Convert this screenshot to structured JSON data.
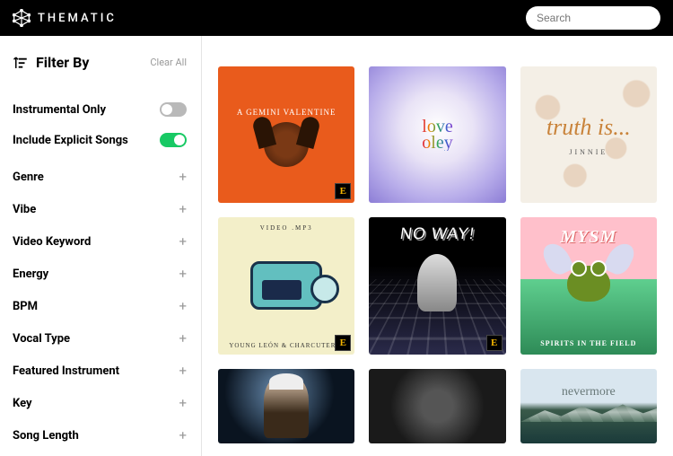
{
  "header": {
    "brand": "THEMATIC",
    "search_placeholder": "Search"
  },
  "sidebar": {
    "title": "Filter By",
    "clear": "Clear All",
    "toggles": [
      {
        "label": "Instrumental Only",
        "on": false
      },
      {
        "label": "Include Explicit Songs",
        "on": true
      }
    ],
    "categories": [
      "Genre",
      "Vibe",
      "Video Keyword",
      "Energy",
      "BPM",
      "Vocal Type",
      "Featured Instrument",
      "Key",
      "Song Length"
    ]
  },
  "albums": [
    {
      "title": "A GEMINI VALENTINE",
      "artist": "",
      "explicit": true
    },
    {
      "title": "love oley",
      "artist": "",
      "explicit": false
    },
    {
      "title": "truth is...",
      "artist": "JINNIE",
      "explicit": false
    },
    {
      "title": "VIDEO .MP3",
      "artist": "YOUNG LEÓN & CHARCUTERIE",
      "explicit": true
    },
    {
      "title": "NO WAY!",
      "artist": "",
      "explicit": true
    },
    {
      "title": "MYSM",
      "artist": "SPIRITS IN THE FIELD",
      "explicit": false
    },
    {
      "title": "",
      "artist": "",
      "explicit": false
    },
    {
      "title": "",
      "artist": "",
      "explicit": false
    },
    {
      "title": "nevermore",
      "artist": "",
      "explicit": false
    }
  ],
  "badge": "E"
}
